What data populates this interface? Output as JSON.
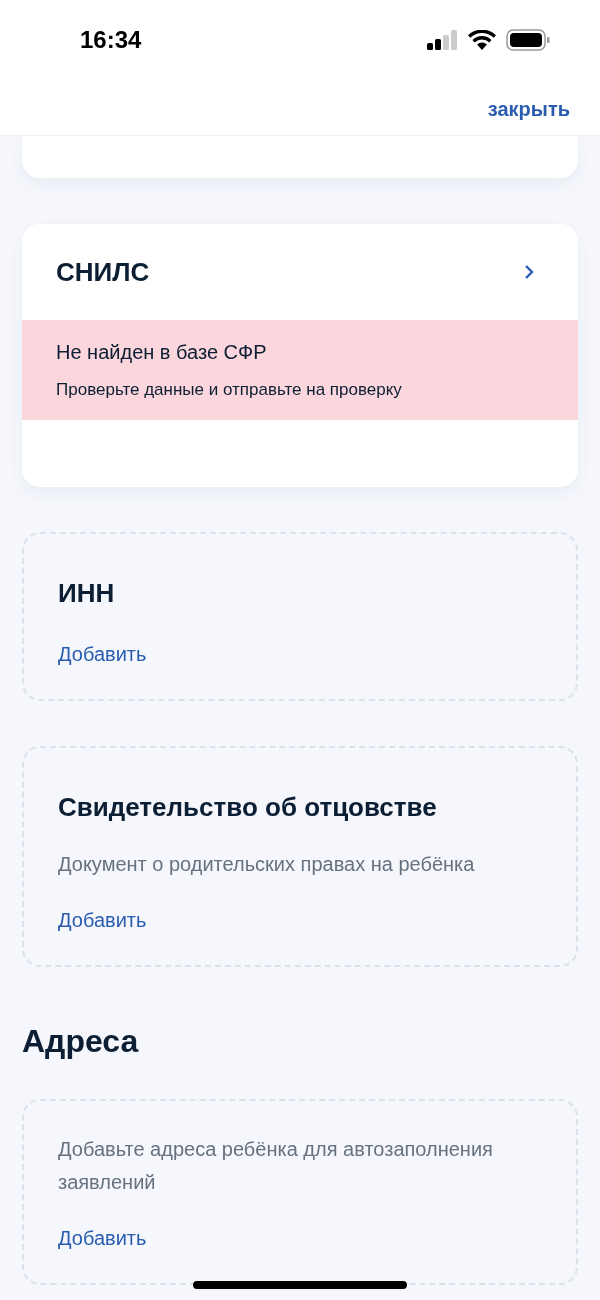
{
  "status_bar": {
    "time": "16:34"
  },
  "header": {
    "close": "закрыть"
  },
  "snils": {
    "title": "СНИЛС",
    "error": {
      "title": "Не найден в базе СФР",
      "message": "Проверьте данные и отправьте на проверку"
    }
  },
  "documents": [
    {
      "title": "ИНН",
      "action": "Добавить"
    },
    {
      "title": "Свидетельство об отцовстве",
      "description": "Документ о родительских правах на ребёнка",
      "action": "Добавить"
    }
  ],
  "addresses": {
    "heading": "Адреса",
    "description": "Добавьте адреса ребёнка для автозаполнения заявлений",
    "action": "Добавить"
  }
}
